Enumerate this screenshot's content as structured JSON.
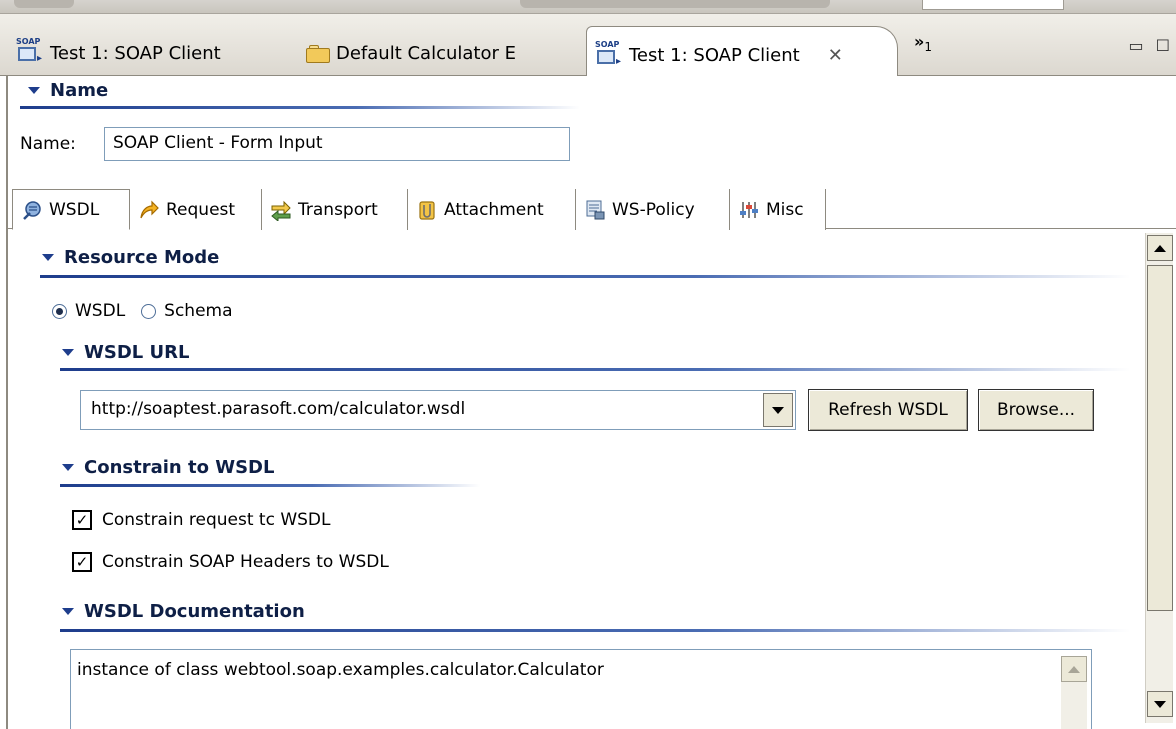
{
  "editor_tabs": [
    {
      "label": "Test 1: SOAP Client",
      "icon": "soap-client-icon"
    },
    {
      "label": "Default Calculator E",
      "icon": "folder-open-icon"
    },
    {
      "label": "Test 1: SOAP Client",
      "icon": "soap-client-icon",
      "active": true
    }
  ],
  "icon_soap_text": "SOAP",
  "overflow_chevron": "»",
  "overflow_count": "1",
  "name_section": {
    "header": "Name",
    "label": "Name:",
    "value": "SOAP Client - Form Input"
  },
  "subtabs": [
    {
      "label": "WSDL",
      "icon": "wsdl-icon",
      "active": true
    },
    {
      "label": "Request",
      "icon": "request-arrow-icon"
    },
    {
      "label": "Transport",
      "icon": "transport-arrows-icon"
    },
    {
      "label": "Attachment",
      "icon": "paperclip-icon"
    },
    {
      "label": "WS-Policy",
      "icon": "ws-policy-icon"
    },
    {
      "label": "Misc",
      "icon": "misc-sliders-icon"
    }
  ],
  "resource_mode": {
    "header": "Resource Mode",
    "options": [
      {
        "label": "WSDL",
        "selected": true
      },
      {
        "label": "Schema",
        "selected": false
      }
    ]
  },
  "wsdl_url": {
    "header": "WSDL URL",
    "value": "http://soaptest.parasoft.com/calculator.wsdl",
    "refresh_label": "Refresh WSDL",
    "browse_label": "Browse..."
  },
  "constrain": {
    "header": "Constrain to WSDL",
    "items": [
      {
        "label": "Constrain request tc WSDL",
        "checked": true
      },
      {
        "label": "Constrain SOAP Headers to WSDL",
        "checked": true
      }
    ]
  },
  "documentation": {
    "header": "WSDL Documentation",
    "text": "instance of class webtool.soap.examples.calculator.Calculator"
  },
  "colors": {
    "section_header_text": "#0e1f46",
    "section_line": "#1e3d8c",
    "tab_border": "#8e8a80",
    "button_face": "#ece9d8"
  }
}
